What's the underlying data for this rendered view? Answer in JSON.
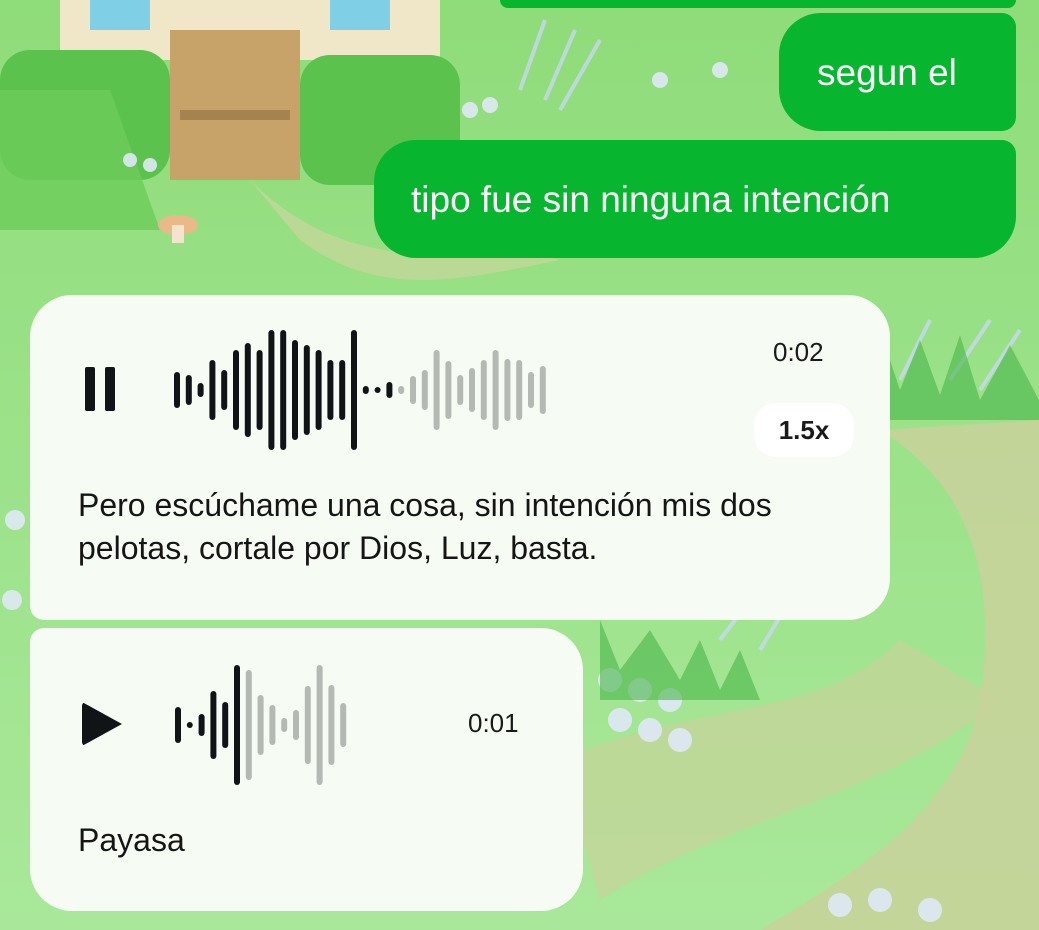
{
  "outgoing": [
    {
      "text": "segun el"
    },
    {
      "text": "tipo fue sin ninguna intención"
    }
  ],
  "voice_notes": [
    {
      "state": "playing",
      "control_icon": "pause-icon",
      "duration": "0:02",
      "speed": "1.5x",
      "progress": 0.6,
      "transcript": "Pero escúchame una cosa, sin intención mis dos pelotas, cortale por Dios, Luz, basta."
    },
    {
      "state": "paused",
      "control_icon": "play-icon",
      "duration": "0:01",
      "progress": 0.4,
      "transcript": "Payasa"
    }
  ],
  "colors": {
    "outgoing_bubble": "#07b52f",
    "incoming_bubble": "#f6fbf4",
    "wave_played": "#111417",
    "wave_unplayed": "#b4b9b4"
  }
}
